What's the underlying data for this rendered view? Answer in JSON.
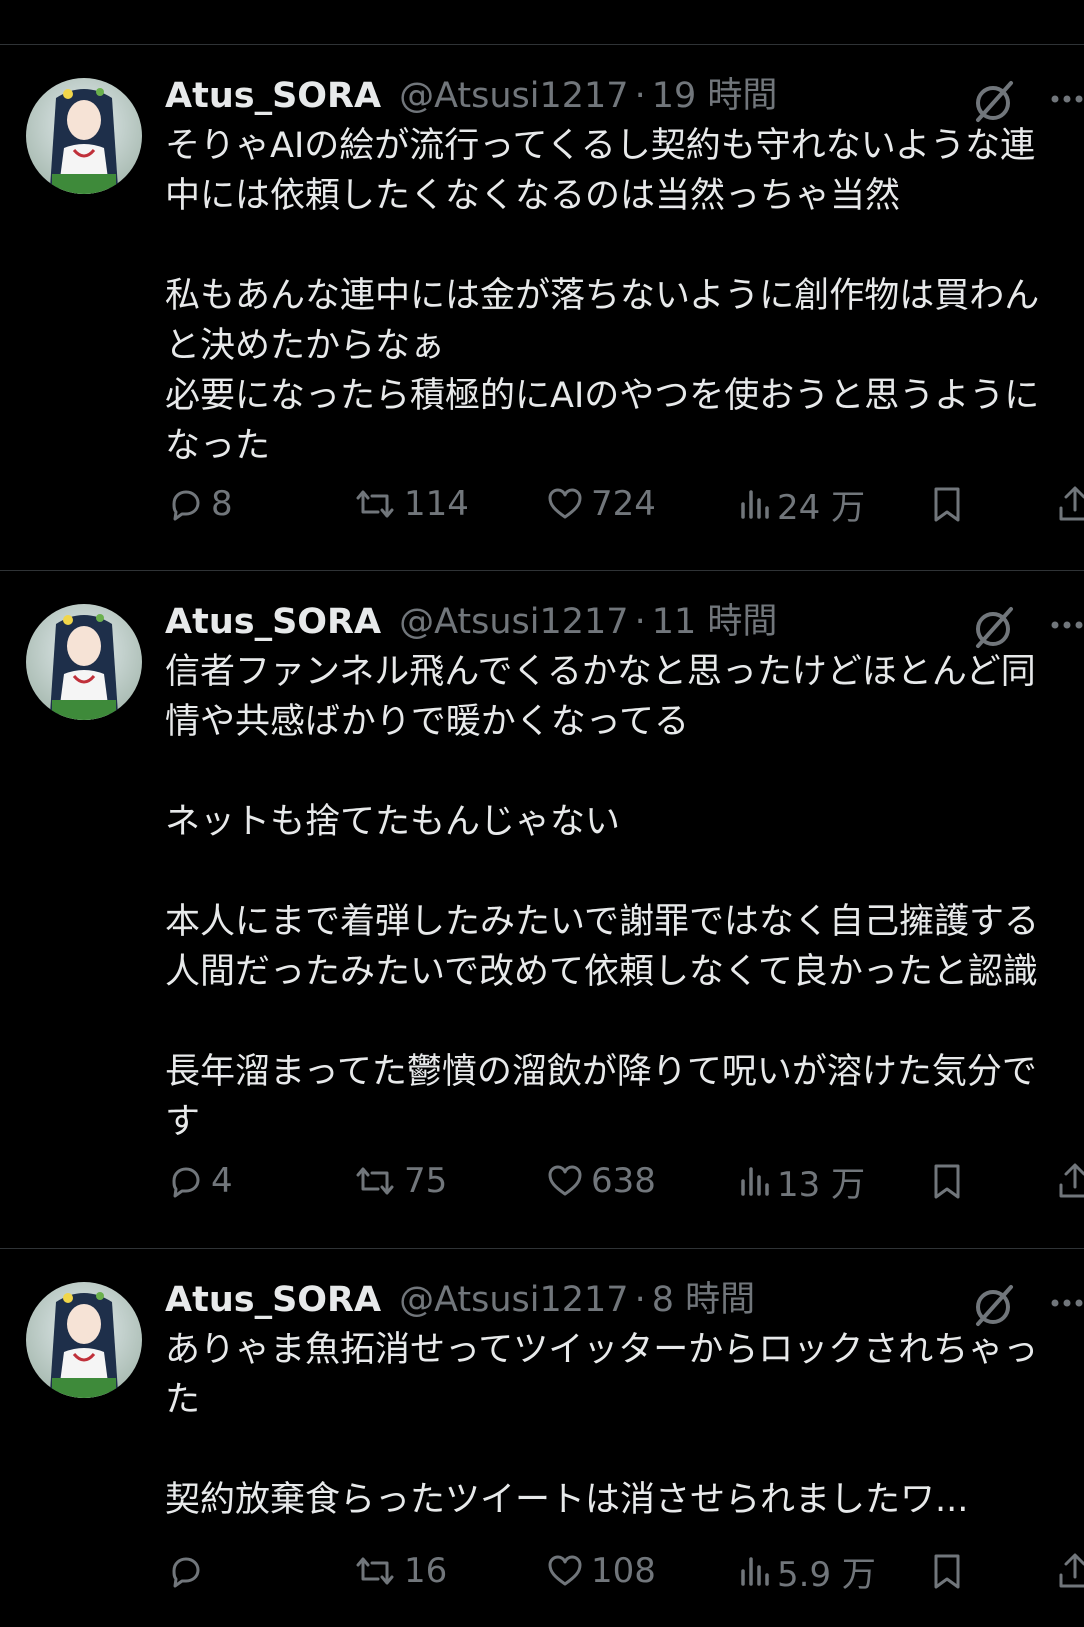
{
  "tweets": [
    {
      "name": "Atus_SORA",
      "handle": "@Atsusi1217",
      "separator": "·",
      "time": "19 時間",
      "lines": [
        "そりゃAIの絵が流行ってくるし契約も守れないような連",
        "中には依頼したくなくなるのは当然っちゃ当然",
        "",
        "私もあんな連中には金が落ちないように創作物は買わん",
        "と決めたからなぁ",
        "必要になったら積極的にAIのやつを使おうと思うように",
        "なった"
      ],
      "replies": "8",
      "retweets": "114",
      "likes": "724",
      "views": "24 万"
    },
    {
      "name": "Atus_SORA",
      "handle": "@Atsusi1217",
      "separator": "·",
      "time": "11 時間",
      "lines": [
        "信者ファンネル飛んでくるかなと思ったけどほとんど同",
        "情や共感ばかりで暖かくなってる",
        "",
        "ネットも捨てたもんじゃない",
        "",
        "本人にまで着弾したみたいで謝罪ではなく自己擁護する",
        "人間だったみたいで改めて依頼しなくて良かったと認識",
        "",
        "長年溜まってた鬱憤の溜飲が降りて呪いが溶けた気分で",
        "す"
      ],
      "replies": "4",
      "retweets": "75",
      "likes": "638",
      "views": "13 万"
    },
    {
      "name": "Atus_SORA",
      "handle": "@Atsusi1217",
      "separator": "·",
      "time": "8 時間",
      "lines": [
        "ありゃま魚拓消せってツイッターからロックされちゃっ",
        "た",
        "",
        "契約放棄食らったツイートは消させられましたワ..."
      ],
      "replies": "",
      "retweets": "16",
      "likes": "108",
      "views": "5.9 万"
    }
  ],
  "icons": {
    "reply": "reply-icon",
    "retweet": "retweet-icon",
    "like": "like-icon",
    "views": "views-icon",
    "bookmark": "bookmark-icon",
    "share": "share-icon",
    "grok": "grok-icon",
    "more": "more-icon"
  },
  "colors": {
    "background": "#000000",
    "text": "#e7e9ea",
    "secondary": "#71767b",
    "divider": "#2f3336"
  }
}
